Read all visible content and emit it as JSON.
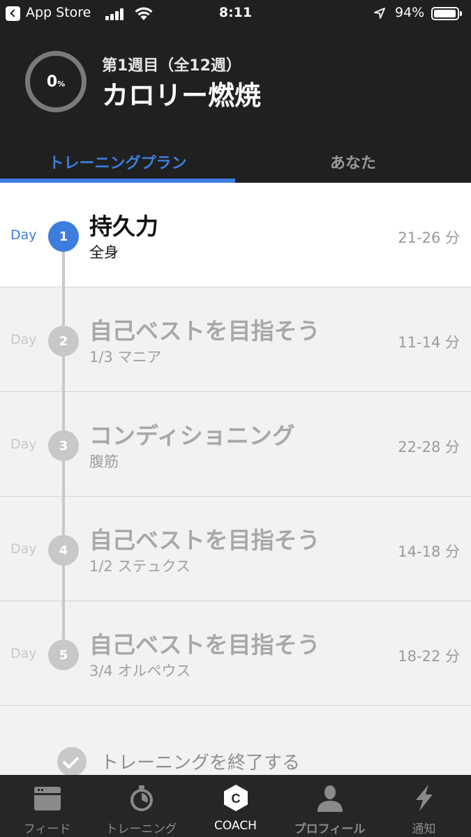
{
  "status_bar": {
    "carrier": "App Store",
    "time": "8:11",
    "battery": "94%"
  },
  "header": {
    "progress_value": "0",
    "progress_unit": "%",
    "week": "第1週目（全12週）",
    "title": "カロリー燃焼"
  },
  "tabs": [
    {
      "label": "トレーニングプラン",
      "active": true
    },
    {
      "label": "あなた",
      "active": false
    }
  ],
  "days": [
    {
      "day_label": "Day",
      "number": "1",
      "title": "持久力",
      "subtitle": "全身",
      "duration": "21-26 分",
      "active": true
    },
    {
      "day_label": "Day",
      "number": "2",
      "title": "自己ベストを目指そう",
      "subtitle": "1/3 マニア",
      "duration": "11-14 分",
      "active": false
    },
    {
      "day_label": "Day",
      "number": "3",
      "title": "コンディショニング",
      "subtitle": "腹筋",
      "duration": "22-28 分",
      "active": false
    },
    {
      "day_label": "Day",
      "number": "4",
      "title": "自己ベストを目指そう",
      "subtitle": "1/2 ステュクス",
      "duration": "14-18 分",
      "active": false
    },
    {
      "day_label": "Day",
      "number": "5",
      "title": "自己ベストを目指そう",
      "subtitle": "3/4 オルペウス",
      "duration": "18-22 分",
      "active": false
    }
  ],
  "finish": {
    "label": "トレーニングを終了する"
  },
  "bottom_nav": [
    {
      "label": "フィード",
      "icon": "feed-icon"
    },
    {
      "label": "トレーニング",
      "icon": "stopwatch-icon"
    },
    {
      "label": "COACH",
      "icon": "coach-icon",
      "active": true
    },
    {
      "label": "プロフィール",
      "icon": "profile-icon"
    },
    {
      "label": "通知",
      "icon": "lightning-icon"
    }
  ],
  "colors": {
    "accent": "#3d7ddd",
    "header_bg": "#202020",
    "nav_bg": "#262626"
  }
}
